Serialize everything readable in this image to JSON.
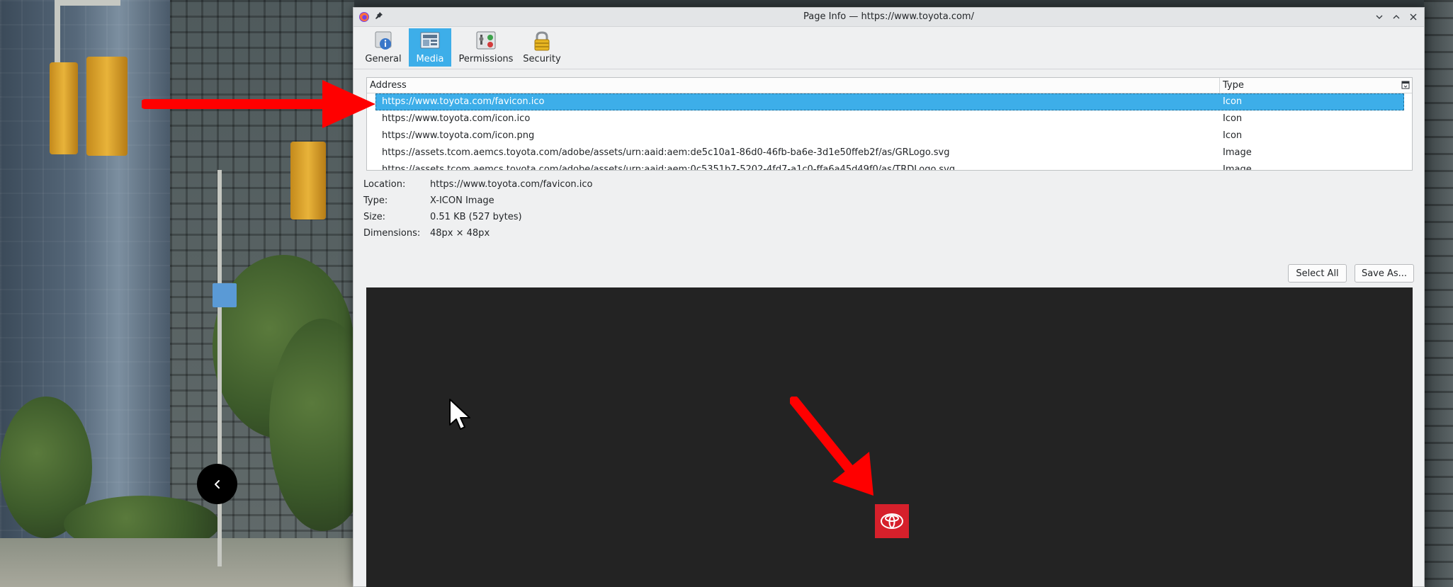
{
  "window": {
    "title": "Page Info — https://www.toyota.com/"
  },
  "tabs": [
    {
      "label": "General",
      "icon": "info-icon",
      "active": false
    },
    {
      "label": "Media",
      "icon": "media-icon",
      "active": true
    },
    {
      "label": "Permissions",
      "icon": "permissions-icon",
      "active": false
    },
    {
      "label": "Security",
      "icon": "lock-icon",
      "active": false
    }
  ],
  "media_table": {
    "headers": {
      "address": "Address",
      "type": "Type"
    },
    "rows": [
      {
        "address": "https://www.toyota.com/favicon.ico",
        "type": "Icon",
        "selected": true
      },
      {
        "address": "https://www.toyota.com/icon.ico",
        "type": "Icon",
        "selected": false
      },
      {
        "address": "https://www.toyota.com/icon.png",
        "type": "Icon",
        "selected": false
      },
      {
        "address": "https://assets.tcom.aemcs.toyota.com/adobe/assets/urn:aaid:aem:de5c10a1-86d0-46fb-ba6e-3d1e50ffeb2f/as/GRLogo.svg",
        "type": "Image",
        "selected": false
      },
      {
        "address": "https://assets.tcom.aemcs.toyota.com/adobe/assets/urn:aaid:aem:0c5351b7-5202-4fd7-a1c0-ffa6a45d49f0/as/TRDLogo.svg",
        "type": "Image",
        "selected": false
      }
    ]
  },
  "details": {
    "location_label": "Location:",
    "location_value": "https://www.toyota.com/favicon.ico",
    "type_label": "Type:",
    "type_value": "X-ICON Image",
    "size_label": "Size:",
    "size_value": "0.51 KB (527 bytes)",
    "dimensions_label": "Dimensions:",
    "dimensions_value": "48px × 48px"
  },
  "buttons": {
    "select_all": "Select All",
    "save_as": "Save As..."
  },
  "colors": {
    "accent": "#3daee9",
    "toyota_red": "#d6202b",
    "annotation_red": "#ff0000",
    "preview_bg": "#232323"
  }
}
